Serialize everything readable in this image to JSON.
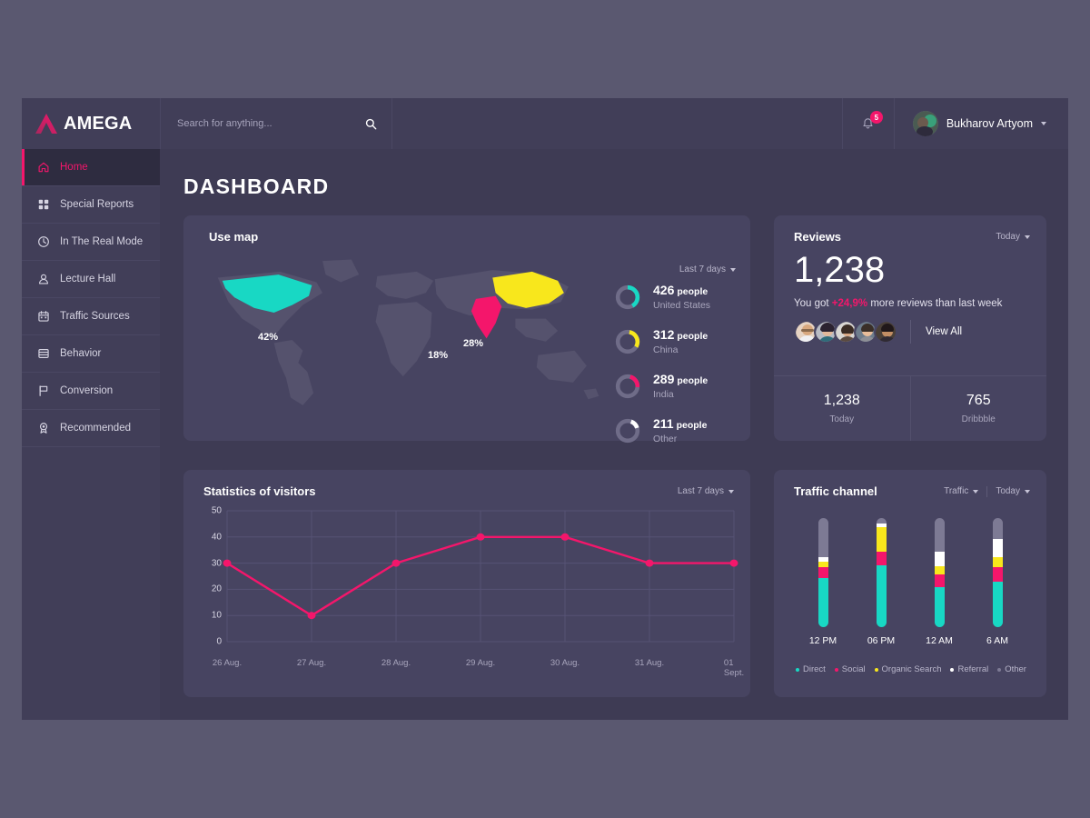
{
  "brand": {
    "name": "AMEGA",
    "logo_icon": "amega-chevron-logo"
  },
  "search": {
    "placeholder": "Search for anything...",
    "value": "",
    "icon": "search-icon"
  },
  "header": {
    "notifications": {
      "icon": "bell-icon",
      "count": "5"
    },
    "user": {
      "name": "Bukharov Artyom",
      "avatar_icon": "user-avatar",
      "caret_icon": "chevron-down-icon"
    }
  },
  "sidebar": {
    "items": [
      {
        "label": "Home",
        "icon": "home-icon",
        "active": true
      },
      {
        "label": "Special Reports",
        "icon": "grid-icon",
        "active": false
      },
      {
        "label": "In The Real Mode",
        "icon": "clock-icon",
        "active": false
      },
      {
        "label": "Lecture Hall",
        "icon": "user-icon",
        "active": false
      },
      {
        "label": "Traffic Sources",
        "icon": "calendar-icon",
        "active": false
      },
      {
        "label": "Behavior",
        "icon": "window-icon",
        "active": false
      },
      {
        "label": "Conversion",
        "icon": "flag-icon",
        "active": false
      },
      {
        "label": "Recommended",
        "icon": "award-icon",
        "active": false
      }
    ]
  },
  "page": {
    "title": "DASHBOARD"
  },
  "colors": {
    "accent_pink": "#f4166b",
    "teal": "#18d8c4",
    "yellow": "#f8e71c",
    "white": "#ffffff",
    "gray": "#7d7a94",
    "card_bg": "#474461",
    "page_bg": "#3e3b54",
    "panel_bg": "#413e58"
  },
  "map_card": {
    "title": "Use map",
    "range_label": "Last 7 days",
    "map_labels": [
      {
        "country": "United States",
        "pct": "42%",
        "color": "#18d8c4"
      },
      {
        "country": "China",
        "pct": "28%",
        "color": "#f8e71c"
      },
      {
        "country": "India",
        "pct": "18%",
        "color": "#f4166b"
      }
    ],
    "legend": [
      {
        "value": "426",
        "unit": "people",
        "country": "United States",
        "color": "#18d8c4",
        "arc_pct": 42
      },
      {
        "value": "312",
        "unit": "people",
        "country": "China",
        "color": "#f8e71c",
        "arc_pct": 28
      },
      {
        "value": "289",
        "unit": "people",
        "country": "India",
        "color": "#f4166b",
        "arc_pct": 18
      },
      {
        "value": "211",
        "unit": "people",
        "country": "Other",
        "color": "#ffffff",
        "arc_pct": 12
      }
    ]
  },
  "reviews_card": {
    "title": "Reviews",
    "range_label": "Today",
    "total": "1,238",
    "subtitle_before": "You got ",
    "delta": "+24,9%",
    "subtitle_after": " more reviews than last week",
    "view_all_label": "View All",
    "avatar_count": 5,
    "stats": [
      {
        "value": "1,238",
        "label": "Today"
      },
      {
        "value": "765",
        "label": "Dribbble"
      }
    ]
  },
  "chart_data": [
    {
      "type": "line",
      "title": "Statistics of visitors",
      "range_label": "Last 7 days",
      "categories": [
        "26 Aug.",
        "27 Aug.",
        "28 Aug.",
        "29 Aug.",
        "30 Aug.",
        "31 Aug.",
        "01 Sept."
      ],
      "values": [
        30,
        10,
        30,
        40,
        40,
        30,
        30
      ],
      "yticks": [
        0,
        10,
        20,
        30,
        40,
        50
      ],
      "ylim": [
        0,
        50
      ],
      "xlabel": "",
      "ylabel": "",
      "grid": true,
      "line_color": "#f4166b"
    },
    {
      "type": "bar",
      "title": "Traffic channel",
      "metric_label": "Traffic",
      "range_label": "Today",
      "categories": [
        "12 PM",
        "06 PM",
        "12 AM",
        "6 AM"
      ],
      "legend": [
        {
          "name": "Direct",
          "color": "#18d8c4"
        },
        {
          "name": "Social",
          "color": "#f4166b"
        },
        {
          "name": "Organic Search",
          "color": "#f8e71c"
        },
        {
          "name": "Referral",
          "color": "#ffffff"
        },
        {
          "name": "Other",
          "color": "#7d7a94"
        }
      ],
      "series": [
        {
          "name": "Direct",
          "values": [
            45,
            57,
            37,
            42
          ]
        },
        {
          "name": "Social",
          "values": [
            10,
            12,
            11,
            13
          ]
        },
        {
          "name": "Organic Search",
          "values": [
            5,
            23,
            8,
            9
          ]
        },
        {
          "name": "Referral",
          "values": [
            4,
            3,
            13,
            17
          ]
        },
        {
          "name": "Other",
          "values": [
            36,
            5,
            31,
            19
          ]
        }
      ],
      "stacked": true,
      "ylim": [
        0,
        100
      ]
    }
  ]
}
